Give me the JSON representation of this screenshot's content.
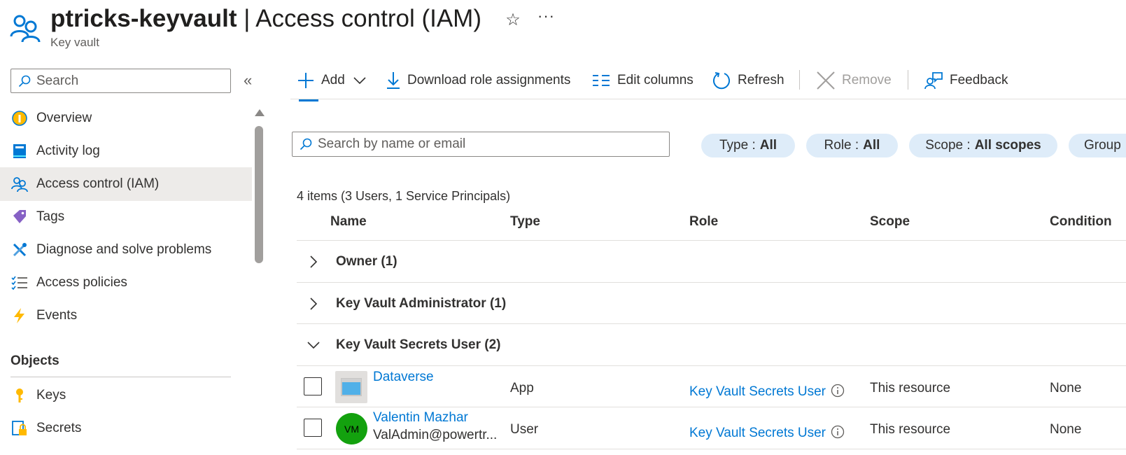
{
  "header": {
    "resource_name": "ptricks-keyvault",
    "separator": " | ",
    "page_name": "Access control (IAM)",
    "subtitle": "Key vault",
    "star_glyph": "☆",
    "more_glyph": "···"
  },
  "sidebar": {
    "search_placeholder": "Search",
    "collapse_glyph": "«",
    "items": [
      {
        "label": "Overview",
        "icon": "overview-icon"
      },
      {
        "label": "Activity log",
        "icon": "activity-log-icon"
      },
      {
        "label": "Access control (IAM)",
        "icon": "people-icon",
        "selected": true
      },
      {
        "label": "Tags",
        "icon": "tag-icon"
      },
      {
        "label": "Diagnose and solve problems",
        "icon": "wrench-icon"
      },
      {
        "label": "Access policies",
        "icon": "checklist-icon"
      },
      {
        "label": "Events",
        "icon": "lightning-icon"
      }
    ],
    "section_objects": "Objects",
    "objects": [
      {
        "label": "Keys",
        "icon": "key-icon"
      },
      {
        "label": "Secrets",
        "icon": "secret-icon"
      }
    ]
  },
  "toolbar": {
    "add": "Add",
    "download": "Download role assignments",
    "edit_columns": "Edit columns",
    "refresh": "Refresh",
    "remove": "Remove",
    "feedback": "Feedback"
  },
  "filters": {
    "search_placeholder": "Search by name or email",
    "type_label": "Type :",
    "type_value": "All",
    "role_label": "Role :",
    "role_value": "All",
    "scope_label": "Scope :",
    "scope_value": "All scopes",
    "group_label": "Group"
  },
  "summary": "4 items (3 Users, 1 Service Principals)",
  "table": {
    "columns": [
      "Name",
      "Type",
      "Role",
      "Scope",
      "Condition"
    ],
    "groups": [
      {
        "label": "Owner (1)",
        "expanded": false
      },
      {
        "label": "Key Vault Administrator (1)",
        "expanded": false
      },
      {
        "label": "Key Vault Secrets User (2)",
        "expanded": true
      }
    ],
    "rows": [
      {
        "name": "Dataverse",
        "subtext": "",
        "avatar": "",
        "type": "App",
        "role": "Key Vault Secrets User",
        "scope": "This resource",
        "condition": "None"
      },
      {
        "name": "Valentin Mazhar",
        "subtext": "ValAdmin@powertr...",
        "avatar": "VM",
        "type": "User",
        "role": "Key Vault Secrets User",
        "scope": "This resource",
        "condition": "None"
      }
    ]
  },
  "colors": {
    "accent": "#0078d4",
    "pill_bg": "#deecf9",
    "avatar_green": "#13a10e",
    "selected_bg": "#edebe9"
  }
}
